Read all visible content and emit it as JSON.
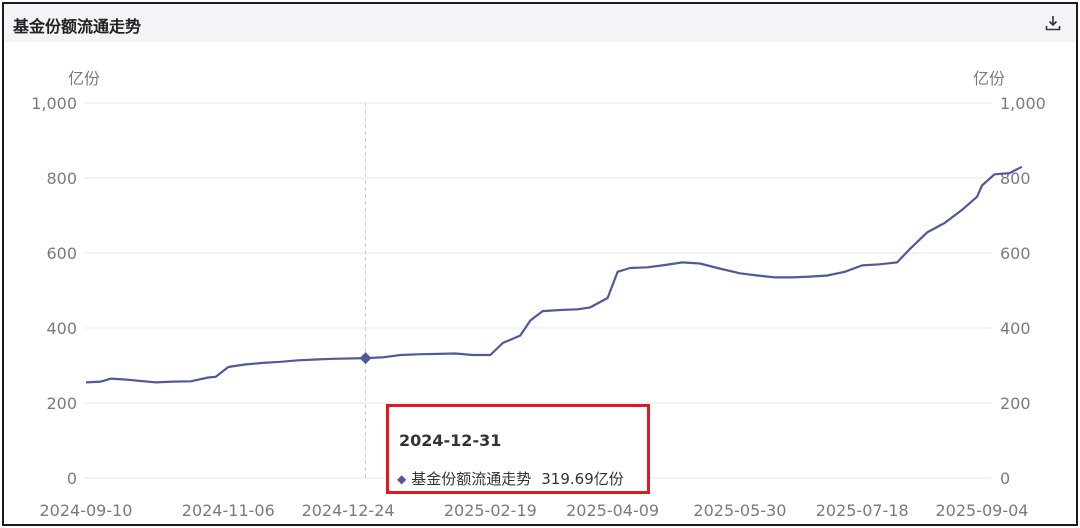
{
  "panel": {
    "title": "基金份额流通走势",
    "download_icon": "download-icon"
  },
  "colors": {
    "line": "#4e5a9a",
    "grid": "#e6e7ec",
    "tooltip_border": "#e0191f",
    "header_bg": "#f3f4f8"
  },
  "tooltip": {
    "date": "2024-12-31",
    "series": "基金份额流通走势",
    "value": "319.69亿份",
    "marker_icon": "diamond-icon"
  },
  "chart_data": {
    "type": "line",
    "y_unit_left": "亿份",
    "y_unit_right": "亿份",
    "ylim": [
      0,
      1000
    ],
    "y_ticks": [
      "0",
      "200",
      "400",
      "600",
      "800",
      "1,000"
    ],
    "x_ticks": [
      "2024-09-10",
      "2024-11-06",
      "2024-12-24",
      "2025-02-19",
      "2025-04-09",
      "2025-05-30",
      "2025-07-18",
      "2025-09-04"
    ],
    "grid": true,
    "highlight": {
      "date": "2024-12-31",
      "value": 319.69
    },
    "series": [
      {
        "name": "基金份额流通走势",
        "points": [
          [
            "2024-09-10",
            255
          ],
          [
            "2024-09-16",
            257
          ],
          [
            "2024-09-20",
            265
          ],
          [
            "2024-09-27",
            262
          ],
          [
            "2024-10-08",
            255
          ],
          [
            "2024-10-15",
            257
          ],
          [
            "2024-10-22",
            258
          ],
          [
            "2024-10-29",
            268
          ],
          [
            "2024-11-01",
            270
          ],
          [
            "2024-11-06",
            296
          ],
          [
            "2024-11-13",
            303
          ],
          [
            "2024-11-20",
            307
          ],
          [
            "2024-11-27",
            310
          ],
          [
            "2024-12-04",
            314
          ],
          [
            "2024-12-11",
            316
          ],
          [
            "2024-12-18",
            318
          ],
          [
            "2024-12-31",
            319.69
          ],
          [
            "2025-01-07",
            322
          ],
          [
            "2025-01-14",
            328
          ],
          [
            "2025-01-21",
            330
          ],
          [
            "2025-02-05",
            332
          ],
          [
            "2025-02-12",
            328
          ],
          [
            "2025-02-19",
            328
          ],
          [
            "2025-02-24",
            360
          ],
          [
            "2025-03-03",
            380
          ],
          [
            "2025-03-07",
            420
          ],
          [
            "2025-03-12",
            445
          ],
          [
            "2025-03-19",
            448
          ],
          [
            "2025-03-26",
            450
          ],
          [
            "2025-03-31",
            455
          ],
          [
            "2025-04-07",
            480
          ],
          [
            "2025-04-11",
            550
          ],
          [
            "2025-04-16",
            560
          ],
          [
            "2025-04-23",
            562
          ],
          [
            "2025-04-30",
            568
          ],
          [
            "2025-05-07",
            575
          ],
          [
            "2025-05-14",
            572
          ],
          [
            "2025-05-21",
            560
          ],
          [
            "2025-05-30",
            546
          ],
          [
            "2025-06-06",
            540
          ],
          [
            "2025-06-13",
            535
          ],
          [
            "2025-06-20",
            535
          ],
          [
            "2025-06-27",
            537
          ],
          [
            "2025-07-04",
            540
          ],
          [
            "2025-07-11",
            550
          ],
          [
            "2025-07-18",
            567
          ],
          [
            "2025-07-25",
            570
          ],
          [
            "2025-08-01",
            575
          ],
          [
            "2025-08-06",
            610
          ],
          [
            "2025-08-13",
            655
          ],
          [
            "2025-08-20",
            680
          ],
          [
            "2025-08-27",
            715
          ],
          [
            "2025-09-02",
            750
          ],
          [
            "2025-09-04",
            780
          ],
          [
            "2025-09-09",
            810
          ],
          [
            "2025-09-15",
            813
          ],
          [
            "2025-09-20",
            830
          ]
        ]
      }
    ]
  }
}
